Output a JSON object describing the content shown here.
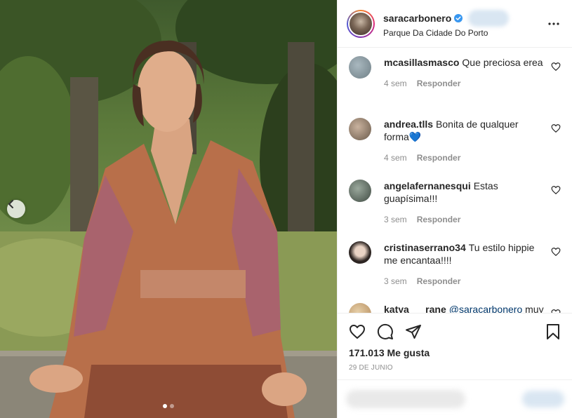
{
  "post": {
    "username": "saracarbonero",
    "location": "Parque Da Cidade Do Porto",
    "likes_text": "171.013 Me gusta",
    "date": "29 DE JUNIO"
  },
  "comments": [
    {
      "user": "mcasillasmasco",
      "text": "Que preciosa erea",
      "time": "4 sem",
      "reply": "Responder",
      "avatar_color": "#6f7f86"
    },
    {
      "user": "andrea.tlls",
      "text": "Bonita de qualquer forma💙",
      "time": "4 sem",
      "reply": "Responder",
      "avatar_color": "#8a7a6a"
    },
    {
      "user": "angelafernanesqui",
      "text": "Estas guapísima!!!",
      "time": "3 sem",
      "reply": "Responder",
      "avatar_color": "#5c6a60"
    },
    {
      "user": "cristinaserrano34",
      "text": "Tu estilo hippie me encantaa!!!!",
      "time": "3 sem",
      "reply": "Responder",
      "avatar_color": "#3d3431"
    },
    {
      "user": "katya___rane",
      "mention": "@saracarbonero",
      "text": "muy",
      "avatar_color": "#c8a67a"
    }
  ],
  "colors": {
    "verified": "#3897f0",
    "border": "#efefef",
    "text": "#262626",
    "meta": "#8e8e8e"
  },
  "icons": [
    "chevron-left-icon",
    "more-icon",
    "verified-icon",
    "heart-icon",
    "comment-icon",
    "share-icon",
    "bookmark-icon"
  ],
  "carousel": {
    "count": 2,
    "active": 1
  }
}
